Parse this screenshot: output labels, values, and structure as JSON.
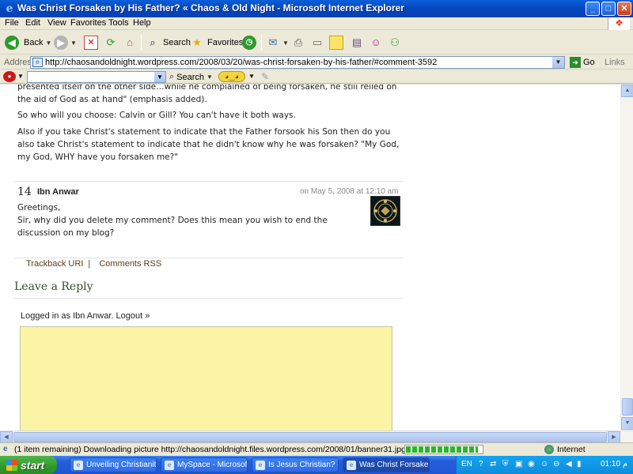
{
  "window": {
    "title": "Was Christ Forsaken by His Father? « Chaos & Old Night - Microsoft Internet Explorer",
    "controls": [
      "_",
      "□",
      "✕"
    ]
  },
  "menu": [
    "File",
    "Edit",
    "View",
    "Favorites",
    "Tools",
    "Help"
  ],
  "toolbar": {
    "back_label": "Back",
    "search_label": "Search",
    "favorites_label": "Favorites"
  },
  "address": {
    "label": "Address",
    "url": "http://chaosandoldnight.wordpress.com/2008/03/20/was-christ-forsaken-by-his-father/#comment-3592",
    "go_label": "Go",
    "links_label": "Links"
  },
  "extra_toolbar": {
    "search_label": "Search"
  },
  "content": {
    "para1": "presented itself on the other side…while he complained of being forsaken, he still relied on the aid of God as at hand\" (emphasis added).",
    "para2": "So who will you choose: Calvin or Gill? You can't have it both ways.",
    "para3": "Also if you take Christ's statement to indicate that the Father forsook his Son then do you also take Christ's statement to indicate that he didn't know why he was forsaken? \"My God, my God, WHY have you forsaken me?\"",
    "comment": {
      "number": "14",
      "author": "Ibn Anwar",
      "date": "on May 5, 2008 at 12:10 am",
      "line1": "Greetings,",
      "line2": "Sir, why did you delete my comment? Does this mean you wish to end the discussion on my blog?"
    },
    "trackback_label": "Trackback URI",
    "trackback_sep": "|",
    "comments_rss_label": "Comments RSS",
    "leave_reply": "Leave a Reply",
    "logged_in_prefix": "Logged in as",
    "logged_in_user": "Ibn Anwar",
    "logout_label": "Logout »"
  },
  "status": {
    "message": "(1 item remaining) Downloading picture http://chaosandoldnight.files.wordpress.com/2008/01/banner31.jpg...",
    "progress_fraction": 0.95,
    "zone": "Internet"
  },
  "taskbar": {
    "start_label": "start",
    "tasks": [
      {
        "label": "Unveiling Christianity..."
      },
      {
        "label": "MySpace - Microsoft ..."
      },
      {
        "label": "Is Jesus Christian? « ..."
      },
      {
        "label": "Was Christ Forsaken ..."
      }
    ],
    "lang": "EN",
    "clock": "01:10 م"
  }
}
